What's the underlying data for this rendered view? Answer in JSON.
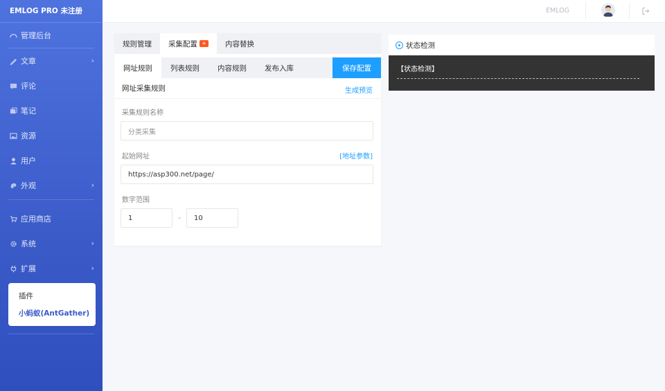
{
  "brand": "EMLOG PRO 未注册",
  "sidebar": {
    "items": [
      {
        "label": "管理后台",
        "icon": "dashboard-icon",
        "chevron": false
      },
      {
        "label": "文章",
        "icon": "pen-icon",
        "chevron": true
      },
      {
        "label": "评论",
        "icon": "comment-icon",
        "chevron": false
      },
      {
        "label": "笔记",
        "icon": "note-icon",
        "chevron": false
      },
      {
        "label": "资源",
        "icon": "image-icon",
        "chevron": false
      },
      {
        "label": "用户",
        "icon": "user-icon",
        "chevron": false
      },
      {
        "label": "外观",
        "icon": "palette-icon",
        "chevron": true
      },
      {
        "label": "应用商店",
        "icon": "cart-icon",
        "chevron": false
      },
      {
        "label": "系统",
        "icon": "gear-icon",
        "chevron": true
      },
      {
        "label": "扩展",
        "icon": "plug-icon",
        "chevron": true
      }
    ],
    "submenu": {
      "item1": "插件",
      "item2": "小蚂蚁(AntGather)"
    }
  },
  "topbar": {
    "link": "EMLOG",
    "avatar_icon": "avatar-icon",
    "logout_icon": "logout-icon"
  },
  "main": {
    "tabs": [
      "规则管理",
      "采集配置",
      "内容替换"
    ],
    "badge": "+",
    "subtabs": [
      "网址规则",
      "列表规则",
      "内容规则",
      "发布入库"
    ],
    "save_label": "保存配置",
    "card_title": "网址采集规则",
    "preview_link": "生成预览",
    "name_label": "采集规则名称",
    "name_placeholder": "分类采集",
    "url_label": "起始网址",
    "url_param_link": "[地址参数]",
    "url_value": "https://asp300.net/page/",
    "range_label": "数字范围",
    "range_from": "1",
    "range_sep": "-",
    "range_to": "10"
  },
  "status": {
    "title": "状态检测",
    "body": "【状态检测】"
  },
  "colors": {
    "accent": "#1e9fff",
    "sidebar": "#4e73df",
    "badge": "#ff5722",
    "console": "#333333"
  }
}
